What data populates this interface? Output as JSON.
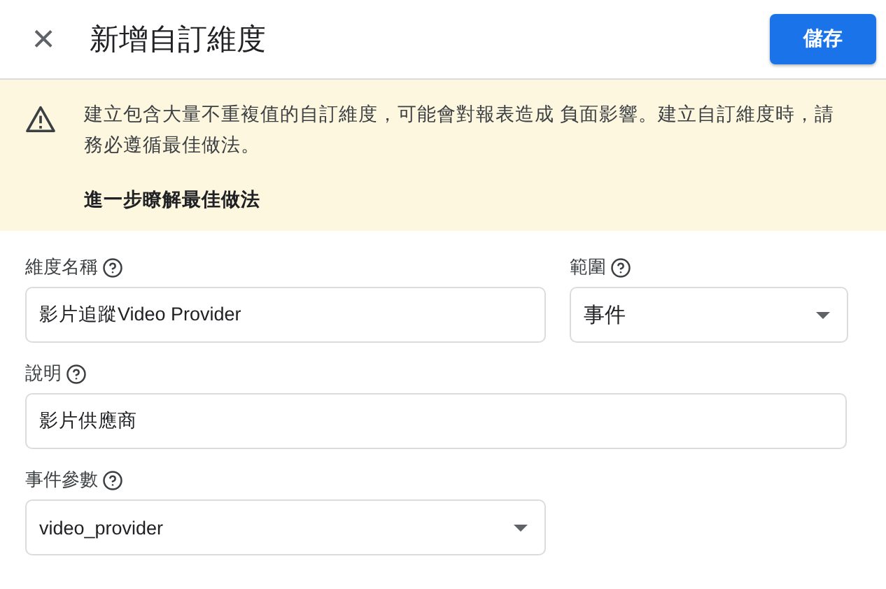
{
  "header": {
    "close_label": "×",
    "title": "新增自訂維度",
    "save_button": "儲存"
  },
  "warning": {
    "message": "建立包含大量不重複值的自訂維度，可能會對報表造成 負面影響。建立自訂維度時，請務必遵循最佳做法。",
    "link": "進一步瞭解最佳做法"
  },
  "field_rows": [
    [
      {
        "label": "維度名稱",
        "kind": "text",
        "value": "影片追蹤Video Provider"
      },
      {
        "label": "範圍",
        "kind": "select",
        "value": "事件"
      }
    ],
    [
      {
        "label": "說明",
        "kind": "text",
        "value": "影片供應商"
      }
    ],
    [
      {
        "label": "事件參數",
        "kind": "select",
        "value": "video_provider"
      }
    ]
  ]
}
